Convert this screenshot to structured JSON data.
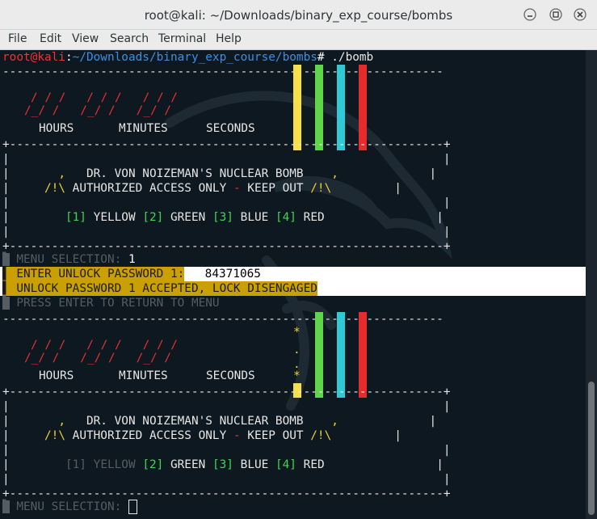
{
  "window": {
    "title": "root@kali: ~/Downloads/binary_exp_course/bombs"
  },
  "menubar": [
    "File",
    "Edit",
    "View",
    "Search",
    "Terminal",
    "Help"
  ],
  "prompt": {
    "user": "root@kali",
    "sep": ":",
    "path": "~/Downloads/binary_exp_course/bombs",
    "hash": "#",
    "command": " ./bomb"
  },
  "timer": {
    "hours": "HOURS",
    "minutes": "MINUTES",
    "seconds": "SECONDS",
    "digits_top": "/ / /   / / /   / / /",
    "digits_bottom": "/_/ /   /_/ /   /_/ /"
  },
  "banner": {
    "comma": ",",
    "title": "DR. VON NOIZEMAN'S NUCLEAR BOMB",
    "warn_icon": "/!\\",
    "access": "AUTHORIZED ACCESS ONLY",
    "dash": "-",
    "keep_out": "KEEP OUT"
  },
  "options": [
    {
      "num": "[1]",
      "label": "YELLOW"
    },
    {
      "num": "[2]",
      "label": "GREEN"
    },
    {
      "num": "[3]",
      "label": "BLUE"
    },
    {
      "num": "[4]",
      "label": "RED"
    }
  ],
  "menu_selection_label": "MENU SELECTION:",
  "menu_selection_value": " 1",
  "unlock_prompt": "ENTER UNLOCK PASSWORD 1:",
  "unlock_value": " 84371065",
  "unlock_result": "UNLOCK PASSWORD 1 ACCEPTED, LOCK DISENGAGED",
  "press_enter": "PRESS ENTER TO RETURN TO MENU",
  "wire_colors": {
    "yellow": "#f5e04a",
    "green": "#5fd64a",
    "cyan": "#2ecbd6",
    "red": "#e52b2b"
  },
  "defused_wire_marks": [
    "*",
    ".",
    ".",
    "*"
  ],
  "border": {
    "top": "---------------------------------------------------------------",
    "edge": "+--------------------------------------------------------------+"
  }
}
